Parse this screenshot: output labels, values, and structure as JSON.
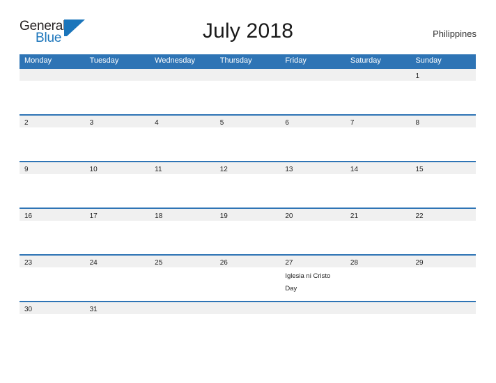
{
  "brand": {
    "word_one": "General",
    "word_two": "Blue",
    "mark_icon": "triangle-flag-icon",
    "color_primary": "#1b75bb",
    "color_text": "#231f20"
  },
  "header": {
    "title": "July 2018",
    "subtitle": "Philippines"
  },
  "theme": {
    "header_blue": "#2e74b5",
    "row_line_blue": "#2e74b5",
    "daynum_band_gray": "#f0f0f0",
    "cell_white": "#ffffff",
    "text_dark": "#222222"
  },
  "calendar": {
    "weekdays": [
      "Monday",
      "Tuesday",
      "Wednesday",
      "Thursday",
      "Friday",
      "Saturday",
      "Sunday"
    ],
    "weeks": [
      {
        "days": [
          {
            "num": "",
            "event": ""
          },
          {
            "num": "",
            "event": ""
          },
          {
            "num": "",
            "event": ""
          },
          {
            "num": "",
            "event": ""
          },
          {
            "num": "",
            "event": ""
          },
          {
            "num": "",
            "event": ""
          },
          {
            "num": "1",
            "event": ""
          }
        ]
      },
      {
        "days": [
          {
            "num": "2",
            "event": ""
          },
          {
            "num": "3",
            "event": ""
          },
          {
            "num": "4",
            "event": ""
          },
          {
            "num": "5",
            "event": ""
          },
          {
            "num": "6",
            "event": ""
          },
          {
            "num": "7",
            "event": ""
          },
          {
            "num": "8",
            "event": ""
          }
        ]
      },
      {
        "days": [
          {
            "num": "9",
            "event": ""
          },
          {
            "num": "10",
            "event": ""
          },
          {
            "num": "11",
            "event": ""
          },
          {
            "num": "12",
            "event": ""
          },
          {
            "num": "13",
            "event": ""
          },
          {
            "num": "14",
            "event": ""
          },
          {
            "num": "15",
            "event": ""
          }
        ]
      },
      {
        "days": [
          {
            "num": "16",
            "event": ""
          },
          {
            "num": "17",
            "event": ""
          },
          {
            "num": "18",
            "event": ""
          },
          {
            "num": "19",
            "event": ""
          },
          {
            "num": "20",
            "event": ""
          },
          {
            "num": "21",
            "event": ""
          },
          {
            "num": "22",
            "event": ""
          }
        ]
      },
      {
        "days": [
          {
            "num": "23",
            "event": ""
          },
          {
            "num": "24",
            "event": ""
          },
          {
            "num": "25",
            "event": ""
          },
          {
            "num": "26",
            "event": ""
          },
          {
            "num": "27",
            "event": "Iglesia ni Cristo Day"
          },
          {
            "num": "28",
            "event": ""
          },
          {
            "num": "29",
            "event": ""
          }
        ]
      },
      {
        "days": [
          {
            "num": "30",
            "event": ""
          },
          {
            "num": "31",
            "event": ""
          },
          {
            "num": "",
            "event": ""
          },
          {
            "num": "",
            "event": ""
          },
          {
            "num": "",
            "event": ""
          },
          {
            "num": "",
            "event": ""
          },
          {
            "num": "",
            "event": ""
          }
        ]
      }
    ]
  }
}
